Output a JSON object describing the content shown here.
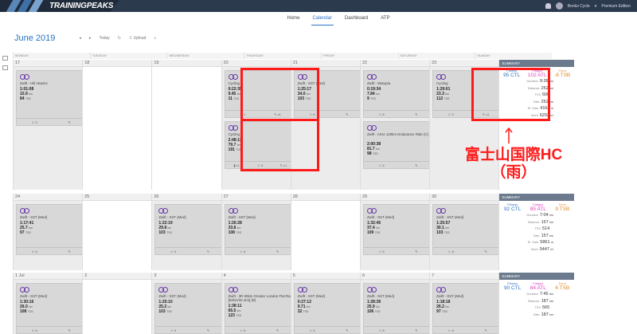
{
  "app": {
    "logo": "TRAININGPEAKS",
    "user": "Bonko Cycle",
    "edition": "Premium Edition"
  },
  "nav": [
    "Home",
    "Calendar",
    "Dashboard",
    "ATP"
  ],
  "header": {
    "month": "June",
    "year": "2019",
    "today": "Today",
    "upload": "Upload"
  },
  "dow": [
    "MONDAY",
    "TUESDAY",
    "WEDNESDAY",
    "THURSDAY",
    "FRIDAY",
    "SATURDAY",
    "SUNDAY"
  ],
  "summary_label": "SUMMARY",
  "labels": {
    "fitness": "Fitness",
    "fatigue": "Fatigue",
    "form": "Form",
    "ctl": "CTL",
    "atl": "ATL",
    "tsb": "TSB",
    "duration": "Duration",
    "distance": "Distance",
    "tss": "TSS",
    "bike": "Bike",
    "elgain": "El. Gain",
    "work": "Work"
  },
  "weeks": [
    {
      "days": [
        "17",
        "18",
        "19",
        "20",
        "21",
        "22",
        "23"
      ],
      "summary": {
        "fitness": "95",
        "fatigue": "102",
        "form": "-8",
        "duration": "9:26",
        "duration_u": "hrs",
        "distance": "252",
        "distance_u": "km",
        "tss": "608",
        "bike": "252",
        "bike_u": "km",
        "elgain": "4164",
        "elgain_u": "m",
        "work": "6293",
        "work_u": "kJ"
      }
    },
    {
      "days": [
        "24",
        "25",
        "26",
        "27",
        "28",
        "29",
        "30"
      ],
      "summary": {
        "fitness": "92",
        "fatigue": "85",
        "form": "9",
        "duration": "7:04",
        "duration_u": "hrs",
        "distance": "157",
        "distance_u": "km",
        "tss": "514",
        "bike": "157",
        "bike_u": "km",
        "elgain": "5861",
        "elgain_u": "m",
        "work": "5447",
        "work_u": "kJ"
      }
    },
    {
      "days": [
        "1 Jul",
        "2",
        "3",
        "4",
        "5",
        "6",
        "7"
      ],
      "summary": {
        "fitness": "90",
        "fatigue": "84",
        "form": "6",
        "duration": "7:45",
        "duration_u": "hrs",
        "distance": "187",
        "distance_u": "km",
        "tss": "565",
        "bike": "187",
        "bike_u": "km"
      }
    }
  ],
  "workouts": {
    "w1mon": {
      "title": "Zwift - Hill Attacks",
      "time": "1:01:08",
      "dist": "15.9",
      "tss": "84",
      "c1": "9"
    },
    "w1thu_a": {
      "title": "Cycling",
      "time": "0:22:35",
      "dist": "9.45",
      "tss": "11",
      "c1": "1",
      "c2": "x1"
    },
    "w1thu_b": {
      "title": "Cycling",
      "time": "2:48:11",
      "dist": "79.7",
      "tss": "191",
      "c0": "x1",
      "c1": "8",
      "c2": "x1"
    },
    "w1fri": {
      "title": "Zwift - SST (Med)",
      "time": "1:25:17",
      "dist": "34.0",
      "tss": "103",
      "c1": "8"
    },
    "w1sat_a": {
      "title": "Zwift - Watopia",
      "time": "0:19:34",
      "dist": "7.84",
      "tss": "9",
      "c1": "8"
    },
    "w1sat_b": {
      "title": "Zwift - ASIA 120km Endurance Ride (C)",
      "time": "2:00:38",
      "dist": "81.7",
      "tss": "98",
      "c1": "8"
    },
    "w1sun": {
      "title": "Cycling",
      "time": "1:29:01",
      "dist": "23.3",
      "tss": "112",
      "c1": "9",
      "c2": "x1"
    },
    "w2mon": {
      "title": "Zwift - SST (Med)",
      "time": "1:17:41",
      "dist": "25.7",
      "tss": "97",
      "c1": "8"
    },
    "w2wed": {
      "title": "Zwift - SST (Med)",
      "time": "1:22:19",
      "dist": "29.8",
      "tss": "103",
      "c1": "8"
    },
    "w2thu": {
      "title": "Zwift - SST (Med)",
      "time": "1:26:28",
      "dist": "33.8",
      "tss": "108",
      "c1": "8"
    },
    "w2sat": {
      "title": "Zwift - SST (Med)",
      "time": "1:32:45",
      "dist": "37.4",
      "tss": "109",
      "c1": "8"
    },
    "w2sun": {
      "title": "Zwift - SST (Med)",
      "time": "1:25:57",
      "dist": "30.1",
      "tss": "103",
      "c1": "8"
    },
    "w3mon": {
      "title": "Zwift - SST (Med)",
      "time": "1:30:16",
      "dist": "26.0",
      "tss": "108",
      "c1": "8"
    },
    "w3wed": {
      "title": "Zwift - SST (Med)",
      "time": "1:25:10",
      "dist": "25.2",
      "tss": "103",
      "c1": "8"
    },
    "w3thu": {
      "title": "Zwift - 3R 50km Greater London Flat Race [52km/32.4mi] (B)",
      "time": "1:38:11",
      "dist": "65.5",
      "tss": "123",
      "c1": "8"
    },
    "w3fri": {
      "title": "Zwift - SST (Med)",
      "time": "0:27:12",
      "dist": "9.71",
      "tss": "32",
      "c1": "8"
    },
    "w3sat": {
      "title": "Zwift - SST (Med)",
      "time": "1:28:39",
      "dist": "25.9",
      "tss": "106",
      "c1": "8"
    },
    "w3sun": {
      "title": "Zwift - SST (Med)",
      "time": "1:18:18",
      "dist": "26.2",
      "tss": "97",
      "c1": "8"
    }
  },
  "units": {
    "km": "km",
    "tss": "TSS"
  },
  "annotation": {
    "arrow": "↑",
    "line1": "富士山国際HC",
    "line2": "（雨）"
  },
  "colors": {
    "accent": "#2a73c5",
    "highlight": "#ff1a1a",
    "fatigue": "#e040c0",
    "form": "#e08a20"
  }
}
